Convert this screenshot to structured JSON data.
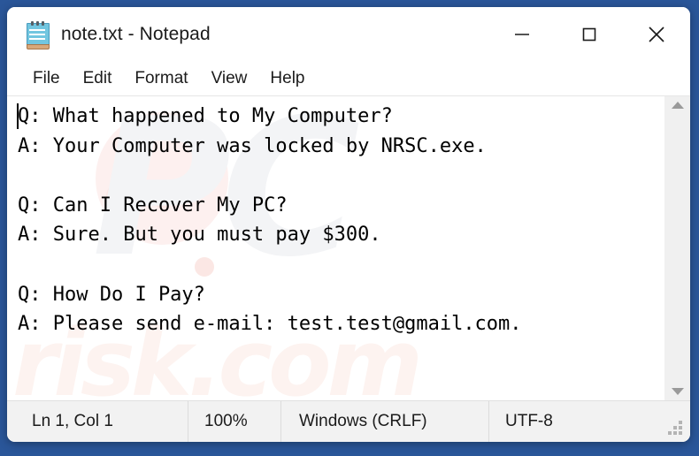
{
  "window": {
    "title": "note.txt - Notepad",
    "icon": "notepad-icon",
    "controls": {
      "minimize_label": "Minimize",
      "maximize_label": "Maximize",
      "close_label": "Close"
    }
  },
  "menubar": {
    "items": [
      {
        "label": "File"
      },
      {
        "label": "Edit"
      },
      {
        "label": "Format"
      },
      {
        "label": "View"
      },
      {
        "label": "Help"
      }
    ]
  },
  "editor": {
    "content": "Q: What happened to My Computer?\nA: Your Computer was locked by NRSC.exe.\n\nQ: Can I Recover My PC?\nA: Sure. But you must pay $300.\n\nQ: How Do I Pay?\nA: Please send e-mail: test.test@gmail.com.",
    "lines": [
      "Q: What happened to My Computer?",
      "A: Your Computer was locked by NRSC.exe.",
      "",
      "Q: Can I Recover My PC?",
      "A: Sure. But you must pay $300.",
      "",
      "Q: How Do I Pay?",
      "A: Please send e-mail: test.test@gmail.com."
    ],
    "watermark_logo": "PC",
    "watermark_text": "risk.com"
  },
  "scrollbar": {
    "up_arrow": "scroll-up-icon",
    "down_arrow": "scroll-down-icon"
  },
  "statusbar": {
    "position": "Ln 1, Col 1",
    "zoom": "100%",
    "line_ending": "Windows (CRLF)",
    "encoding": "UTF-8"
  },
  "colors": {
    "desktop": "#2a5699",
    "window": "#ffffff",
    "statusbar": "#f2f2f2",
    "text": "#000000",
    "icon_blue": "#72c6e0"
  }
}
